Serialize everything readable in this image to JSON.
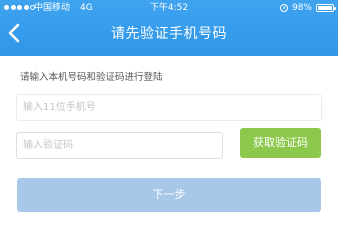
{
  "status_bar": {
    "carrier": "中国移动",
    "network": "4G",
    "time": "下午4:52",
    "battery_percent": "98%",
    "battery_level": 0.98,
    "signal_bars_filled": 4,
    "signal_bars_total": 5,
    "icons": [
      "signal-icon",
      "lock-rotation-icon",
      "battery-icon"
    ]
  },
  "nav": {
    "back_icon": "chevron-left-icon",
    "title": "请先验证手机号码"
  },
  "form": {
    "instruction": "请输入本机号码和验证码进行登陆",
    "phone": {
      "value": "",
      "placeholder": "输入11位手机号"
    },
    "code": {
      "value": "",
      "placeholder": "输入验证码"
    },
    "get_code_label": "获取验证码",
    "next_label": "下一步"
  },
  "colors": {
    "header_blue": "#3a9eec",
    "get_code_green": "#8cc84b",
    "next_button_disabled_blue": "#a9c7e8",
    "instruction_text": "#555555",
    "placeholder_text": "#c4c4c4"
  }
}
